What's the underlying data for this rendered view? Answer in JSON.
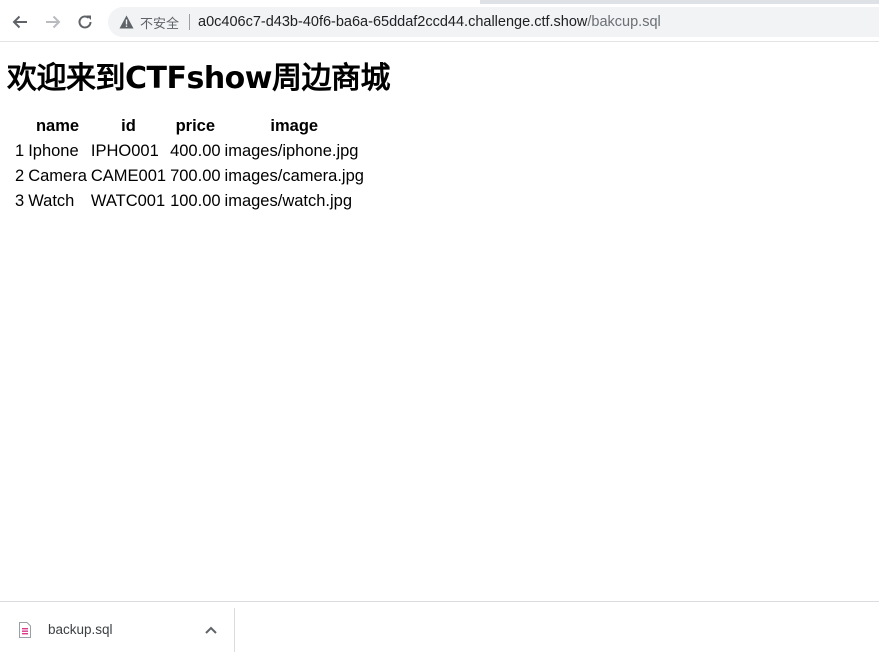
{
  "browser": {
    "security_label": "不安全",
    "url_host": "a0c406c7-d43b-40f6-ba6a-65ddaf2ccd44.challenge.ctf.show",
    "url_path": "/bakcup.sql",
    "icons": {
      "back": "arrow-left-icon",
      "forward": "arrow-right-icon",
      "reload": "reload-icon",
      "security": "warning-triangle-icon"
    }
  },
  "page": {
    "heading": "欢迎来到CTFshow周边商城",
    "table": {
      "headers": [
        "",
        "name",
        "id",
        "price",
        "image"
      ],
      "rows": [
        [
          "1",
          "Iphone",
          "IPHO001",
          "400.00",
          "images/iphone.jpg"
        ],
        [
          "2",
          "Camera",
          "CAME001",
          "700.00",
          "images/camera.jpg"
        ],
        [
          "3",
          "Watch",
          "WATC001",
          "100.00",
          "images/watch.jpg"
        ]
      ]
    }
  },
  "download_bar": {
    "file_name": "backup.sql",
    "icons": {
      "file": "document-icon",
      "expand": "chevron-up-icon"
    }
  }
}
